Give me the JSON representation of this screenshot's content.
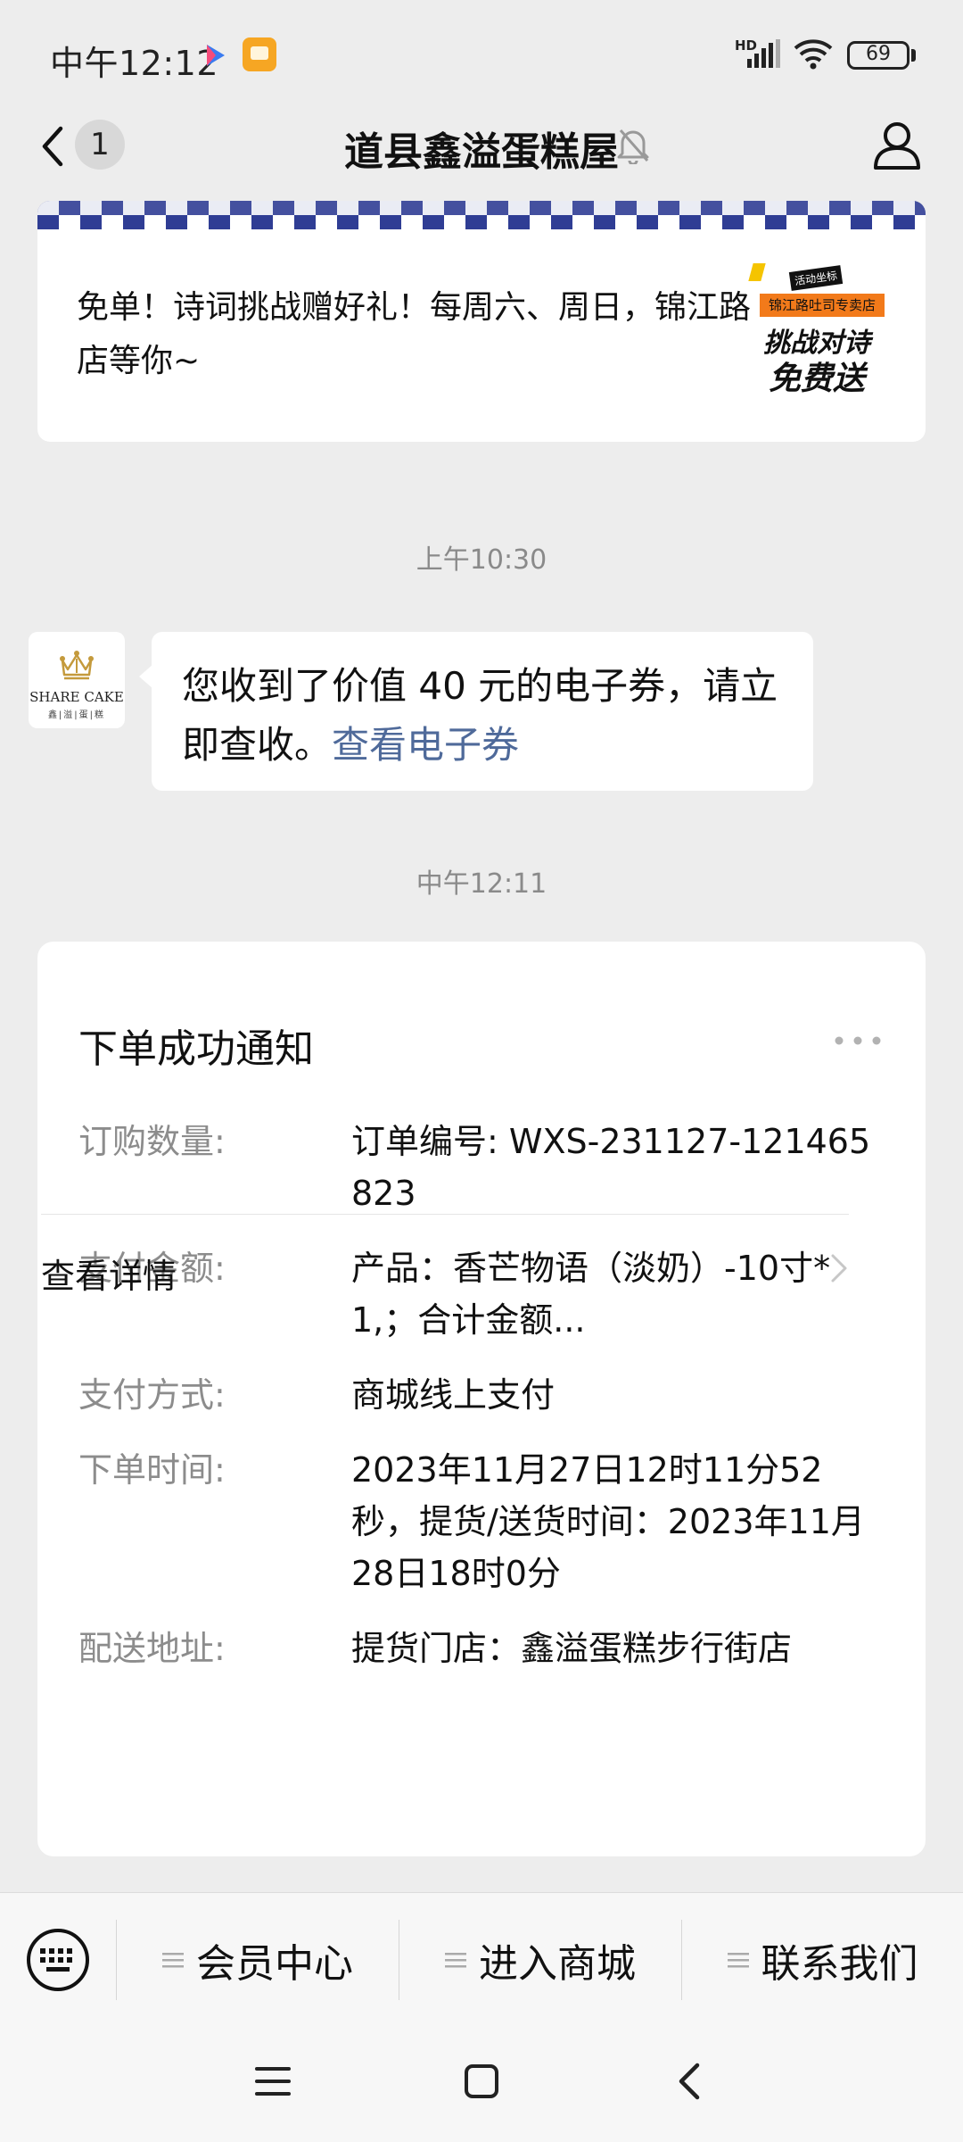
{
  "status_bar": {
    "time": "中午12:12",
    "network_label": "HD",
    "battery": "69"
  },
  "nav": {
    "unread_count": "1",
    "title": "道县鑫溢蛋糕屋"
  },
  "promo": {
    "text": "免单！诗词挑战赠好礼！每周六、周日，锦江路店等你~",
    "thumb_tag": "活动坐标",
    "thumb_store": "锦江路吐司专卖店",
    "thumb_line1": "挑战对诗",
    "thumb_line2": "免费送"
  },
  "timestamps": {
    "first": "上午10:30",
    "second": "中午12:11"
  },
  "avatar": {
    "brand": "SHARE CAKE",
    "sub": "鑫|溢|蛋|糕"
  },
  "coupon_message": {
    "text": "您收到了价值 40 元的电子券，请立即查收。",
    "link": "查看电子券"
  },
  "order_card": {
    "title": "下单成功通知",
    "rows": [
      {
        "label": "订购数量:",
        "value": "订单编号: WXS-231127-121465823"
      },
      {
        "label": "支付金额:",
        "value": "产品：香芒物语（淡奶）-10寸*1,；合计金额..."
      },
      {
        "label": "支付方式:",
        "value": "商城线上支付"
      },
      {
        "label": "下单时间:",
        "value": "2023年11月27日12时11分52秒，提货/送货时间：2023年11月28日18时0分"
      },
      {
        "label": "配送地址:",
        "value": "提货门店：鑫溢蛋糕步行街店"
      }
    ],
    "details_label": "查看详情"
  },
  "bottom_menu": {
    "items": [
      {
        "label": "会员中心"
      },
      {
        "label": "进入商城"
      },
      {
        "label": "联系我们"
      }
    ]
  },
  "colors": {
    "background": "#ededed",
    "link": "#4f6a9a",
    "promo_orange": "#f27a1a",
    "banner_blue": "#2f3d94"
  }
}
